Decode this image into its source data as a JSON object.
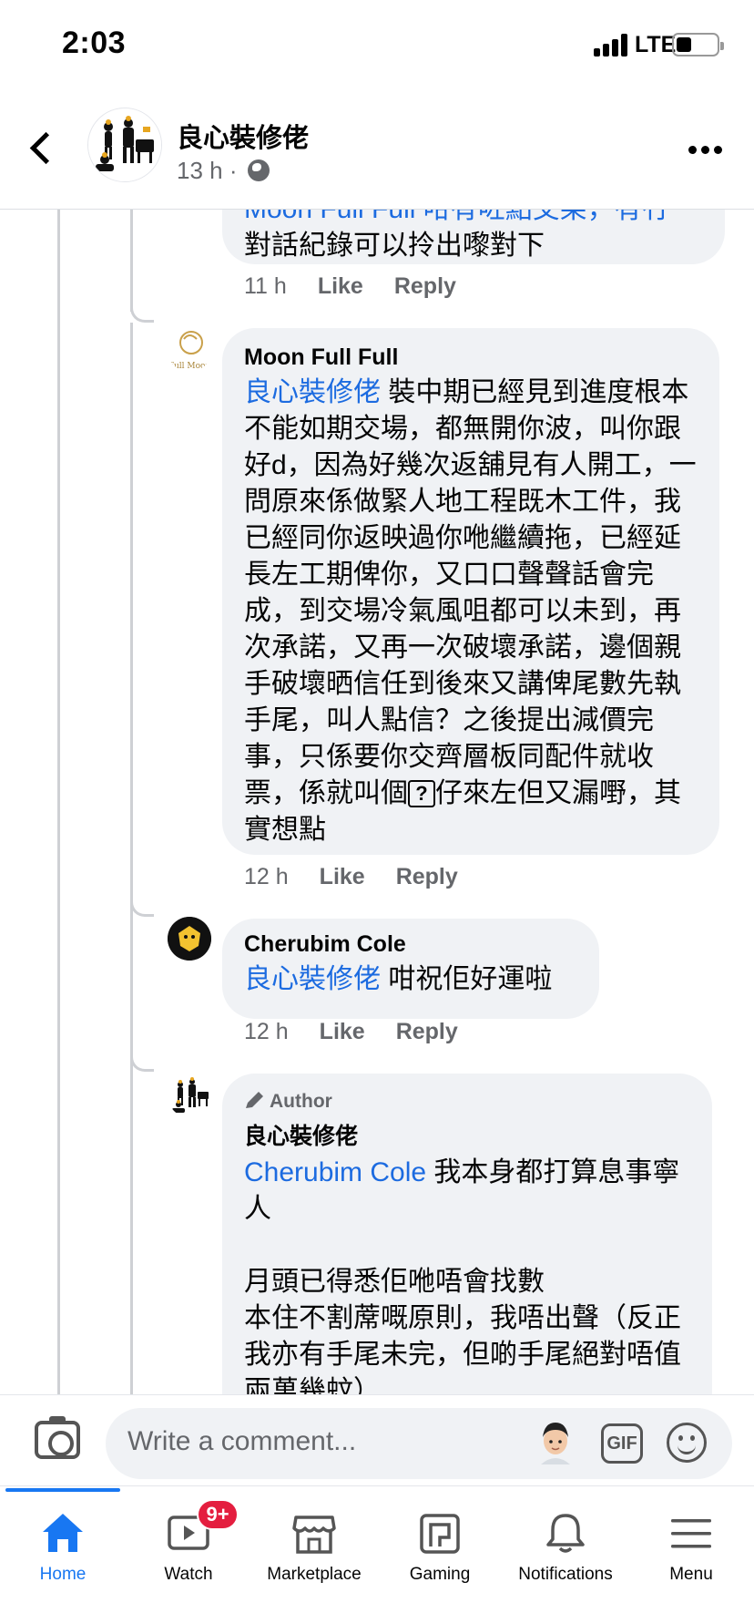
{
  "status_bar": {
    "time": "2:03",
    "network": "LTE"
  },
  "header": {
    "page_name": "良心裝修佬",
    "post_time": "13 h ·"
  },
  "comments": {
    "partial": {
      "line_1": "Moon Full Full 咁有咗點交架，有冇",
      "line_2": "對話紀錄可以拎出嚟對下",
      "time": "11 h",
      "like": "Like",
      "reply": "Reply"
    },
    "moon": {
      "author": "Moon Full Full",
      "avatar_text": "Full Moon",
      "mention": "良心裝修佬",
      "text": " 裝中期已經見到進度根本不能如期交場，都無開你波，叫你跟好d，因為好幾次返舖見有人開工，一問原來係做緊人地工程既木工件，我已經同你返映過你咃繼續拖，已經延長左工期俾你，又口口聲聲話會完成，到交場冷氣風咀都可以未到，再次承諾，又再一次破壞承諾，邊個親手破壞晒信任到後來又講俾尾數先執手尾，叫人點信？之後提出減價完事，只係要你交齊層板同配件就收票，係就叫個",
      "question_glyph": "?",
      "text_end": "仔來左但又漏嘢，其實想點",
      "time": "12 h",
      "like": "Like",
      "reply": "Reply"
    },
    "cherubim": {
      "author": "Cherubim Cole",
      "mention": "良心裝修佬",
      "text": " 咁祝佢好運啦",
      "time": "12 h",
      "like": "Like",
      "reply": "Reply"
    },
    "page_reply": {
      "badge": "Author",
      "author": "良心裝修佬",
      "mention": "Cherubim Cole",
      "text_1": " 我本身都打算息事寧人",
      "text_2": "月頭已得悉佢咃唔會找數",
      "text_3": "本住不割蓆嘅原則，我唔出聲（反正我亦有手尾未完，但啲手尾絕對唔值兩萬幾蚊）"
    }
  },
  "composer": {
    "placeholder": "Write a comment...",
    "gif_label": "GIF"
  },
  "tabs": [
    {
      "label": "Home",
      "icon": "home-icon",
      "active": true
    },
    {
      "label": "Watch",
      "icon": "watch-icon",
      "badge": "9+"
    },
    {
      "label": "Marketplace",
      "icon": "marketplace-icon"
    },
    {
      "label": "Gaming",
      "icon": "gaming-icon"
    },
    {
      "label": "Notifications",
      "icon": "bell-icon"
    },
    {
      "label": "Menu",
      "icon": "menu-icon"
    }
  ],
  "colors": {
    "accent": "#1877f2",
    "mention": "#1c6be0",
    "badge": "#e41e3f",
    "bubble": "#f0f2f5"
  }
}
